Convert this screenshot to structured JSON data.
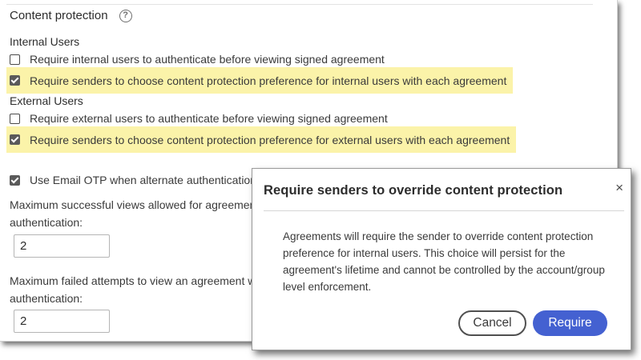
{
  "section": {
    "title": "Content protection",
    "help_icon": "?"
  },
  "internal": {
    "label": "Internal Users",
    "opt1": {
      "label": "Require internal users to authenticate before viewing signed agreement",
      "checked": false
    },
    "opt2": {
      "label": "Require senders to choose content protection preference for internal users with each agreement",
      "checked": true
    }
  },
  "external": {
    "label": "External Users",
    "opt1": {
      "label": "Require external users to authenticate before viewing signed agreement",
      "checked": false
    },
    "opt2": {
      "label": "Require senders to choose content protection preference for external users with each agreement",
      "checked": true
    }
  },
  "otp": {
    "label": "Use Email OTP when alternate authentication m",
    "checked": true
  },
  "max_views": {
    "label_line1": "Maximum successful views allowed for agreement w",
    "label_line2": "authentication:",
    "value": "2"
  },
  "max_failed": {
    "label_line1": "Maximum failed attempts to view an agreement wit",
    "label_line2": "authentication:",
    "value": "2"
  },
  "modal": {
    "title": "Require senders to override content protection",
    "close_glyph": "×",
    "body": "Agreements will require the sender to override content protection preference for internal users. This choice will persist for the agreement's lifetime and cannot be controlled by the account/group level enforcement.",
    "cancel_label": "Cancel",
    "require_label": "Require"
  },
  "colors": {
    "highlight": "#fbf3a9",
    "primary_button": "#4461d1"
  }
}
